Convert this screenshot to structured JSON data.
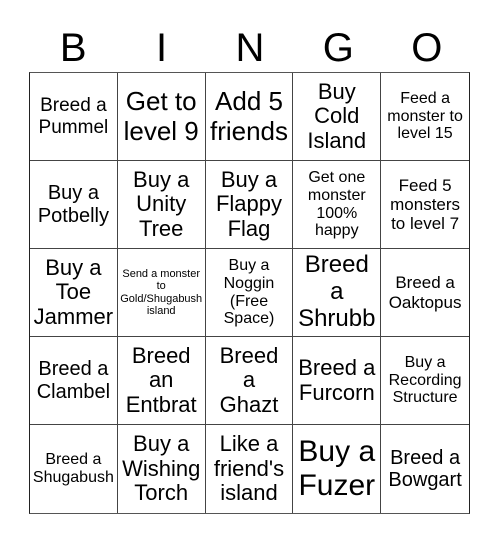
{
  "header": {
    "letters": [
      "B",
      "I",
      "N",
      "G",
      "O"
    ]
  },
  "cells": [
    "Breed a Pummel",
    "Get to level 9",
    "Add 5 friends",
    "Buy Cold Island",
    "Feed a monster to level 15",
    "Buy a Potbelly",
    "Buy a Unity Tree",
    "Buy a Flappy Flag",
    "Get one monster 100% happy",
    "Feed 5 monsters to level 7",
    "Buy a Toe Jammer",
    "Send a monster to Gold/Shugabush island",
    "Buy a Noggin (Free Space)",
    "Breed a Shrubb",
    "Breed a Oaktopus",
    "Breed a Clambel",
    "Breed an Entbrat",
    "Breed a Ghazt",
    "Breed a Furcorn",
    "Buy a Recording Structure",
    "Breed a Shugabush",
    "Buy a Wishing Torch",
    "Like a friend's island",
    "Buy a Fuzer",
    "Breed a Bowgart"
  ]
}
